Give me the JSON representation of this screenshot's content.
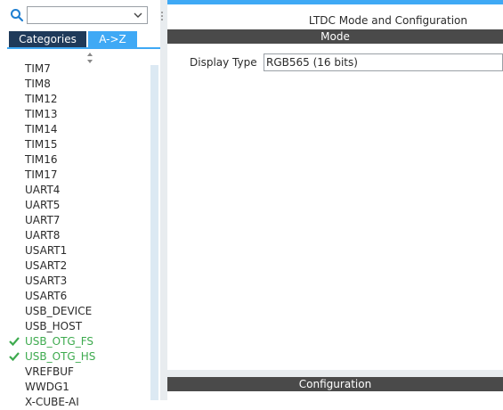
{
  "sidebar": {
    "search": {
      "value": "",
      "placeholder": ""
    },
    "tabs": [
      {
        "label": "Categories",
        "active": false
      },
      {
        "label": "A->Z",
        "active": true
      }
    ],
    "items": [
      {
        "label": "TIM7",
        "enabled": false
      },
      {
        "label": "TIM8",
        "enabled": false
      },
      {
        "label": "TIM12",
        "enabled": false
      },
      {
        "label": "TIM13",
        "enabled": false
      },
      {
        "label": "TIM14",
        "enabled": false
      },
      {
        "label": "TIM15",
        "enabled": false
      },
      {
        "label": "TIM16",
        "enabled": false
      },
      {
        "label": "TIM17",
        "enabled": false
      },
      {
        "label": "UART4",
        "enabled": false
      },
      {
        "label": "UART5",
        "enabled": false
      },
      {
        "label": "UART7",
        "enabled": false
      },
      {
        "label": "UART8",
        "enabled": false
      },
      {
        "label": "USART1",
        "enabled": false
      },
      {
        "label": "USART2",
        "enabled": false
      },
      {
        "label": "USART3",
        "enabled": false
      },
      {
        "label": "USART6",
        "enabled": false
      },
      {
        "label": "USB_DEVICE",
        "enabled": false
      },
      {
        "label": "USB_HOST",
        "enabled": false
      },
      {
        "label": "USB_OTG_FS",
        "enabled": true
      },
      {
        "label": "USB_OTG_HS",
        "enabled": true
      },
      {
        "label": "VREFBUF",
        "enabled": false
      },
      {
        "label": "WWDG1",
        "enabled": false
      },
      {
        "label": "X-CUBE-AI",
        "enabled": false
      }
    ]
  },
  "main": {
    "title": "LTDC Mode and Configuration",
    "mode_section": {
      "label": "Mode"
    },
    "display_type": {
      "label": "Display Type",
      "value": "RGB565 (16 bits)"
    },
    "config_section": {
      "label": "Configuration"
    }
  },
  "colors": {
    "accent": "#3fa9f5",
    "tab_dark": "#1f3a5a",
    "section_bar": "#4a4a4a",
    "enabled_green": "#3daa4e"
  }
}
